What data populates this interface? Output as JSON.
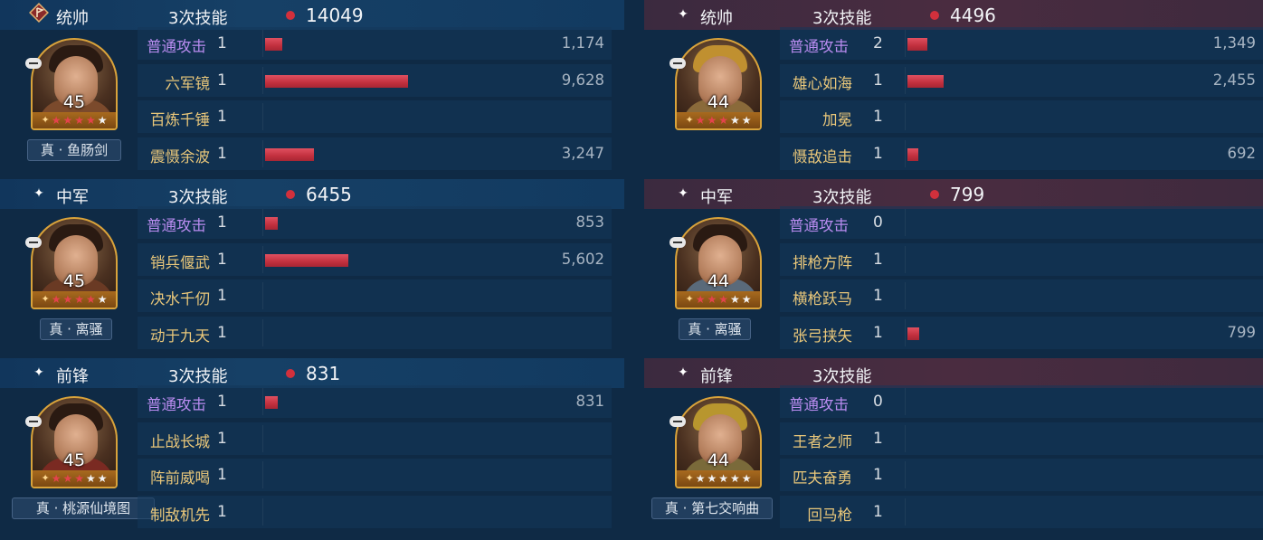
{
  "left": {
    "blocks": [
      {
        "role": "统帅",
        "role_icon": "flag-diamond-icon",
        "skills_label": "3次技能",
        "total": "14049",
        "hero": {
          "level": "45",
          "stars_red": 4,
          "equipment": "真 · 鱼肠剑"
        },
        "rows": [
          {
            "name": "普通攻击",
            "count": "1",
            "bar_fraction": 0.022,
            "damage": "1,174",
            "normal": true
          },
          {
            "name": "六军镜",
            "count": "1",
            "bar_fraction": 0.18,
            "damage": "9,628",
            "normal": false
          },
          {
            "name": "百炼千锤",
            "count": "1",
            "bar_fraction": 0,
            "damage": "",
            "normal": false
          },
          {
            "name": "震慑余波",
            "count": "1",
            "bar_fraction": 0.061,
            "damage": "3,247",
            "normal": false
          }
        ]
      },
      {
        "role": "中军",
        "role_icon": "sparkle-icon",
        "skills_label": "3次技能",
        "total": "6455",
        "hero": {
          "level": "45",
          "stars_red": 4,
          "equipment": "真 · 离骚"
        },
        "rows": [
          {
            "name": "普通攻击",
            "count": "1",
            "bar_fraction": 0.016,
            "damage": "853",
            "normal": true
          },
          {
            "name": "销兵偃武",
            "count": "1",
            "bar_fraction": 0.105,
            "damage": "5,602",
            "normal": false
          },
          {
            "name": "决水千仞",
            "count": "1",
            "bar_fraction": 0,
            "damage": "",
            "normal": false
          },
          {
            "name": "动于九天",
            "count": "1",
            "bar_fraction": 0,
            "damage": "",
            "normal": false
          }
        ]
      },
      {
        "role": "前锋",
        "role_icon": "sparkle-icon",
        "skills_label": "3次技能",
        "total": "831",
        "hero": {
          "level": "45",
          "stars_red": 3,
          "equipment": "真 · 桃源仙境图"
        },
        "rows": [
          {
            "name": "普通攻击",
            "count": "1",
            "bar_fraction": 0.016,
            "damage": "831",
            "normal": true
          },
          {
            "name": "止战长城",
            "count": "1",
            "bar_fraction": 0,
            "damage": "",
            "normal": false
          },
          {
            "name": "阵前威喝",
            "count": "1",
            "bar_fraction": 0,
            "damage": "",
            "normal": false
          },
          {
            "name": "制敌机先",
            "count": "1",
            "bar_fraction": 0,
            "damage": "",
            "normal": false
          }
        ]
      }
    ]
  },
  "right": {
    "blocks": [
      {
        "role": "统帅",
        "role_icon": "sparkle-icon",
        "skills_label": "3次技能",
        "total": "4496",
        "hero": {
          "level": "44",
          "stars_red": 3,
          "equipment": ""
        },
        "rows": [
          {
            "name": "普通攻击",
            "count": "2",
            "bar_fraction": 0.025,
            "damage": "1,349",
            "normal": true
          },
          {
            "name": "雄心如海",
            "count": "1",
            "bar_fraction": 0.046,
            "damage": "2,455",
            "normal": false
          },
          {
            "name": "加冕",
            "count": "1",
            "bar_fraction": 0,
            "damage": "",
            "normal": false
          },
          {
            "name": "慑敌追击",
            "count": "1",
            "bar_fraction": 0.013,
            "damage": "692",
            "normal": false
          }
        ]
      },
      {
        "role": "中军",
        "role_icon": "sparkle-icon",
        "skills_label": "3次技能",
        "total": "799",
        "hero": {
          "level": "44",
          "stars_red": 3,
          "equipment": "真 · 离骚"
        },
        "rows": [
          {
            "name": "普通攻击",
            "count": "0",
            "bar_fraction": 0,
            "damage": "",
            "normal": true
          },
          {
            "name": "排枪方阵",
            "count": "1",
            "bar_fraction": 0,
            "damage": "",
            "normal": false
          },
          {
            "name": "横枪跃马",
            "count": "1",
            "bar_fraction": 0,
            "damage": "",
            "normal": false
          },
          {
            "name": "张弓挟矢",
            "count": "1",
            "bar_fraction": 0.015,
            "damage": "799",
            "normal": false
          }
        ]
      },
      {
        "role": "前锋",
        "role_icon": "sparkle-icon",
        "skills_label": "3次技能",
        "total": "",
        "hero": {
          "level": "44",
          "stars_red": 0,
          "equipment": "真 · 第七交响曲"
        },
        "rows": [
          {
            "name": "普通攻击",
            "count": "0",
            "bar_fraction": 0,
            "damage": "",
            "normal": true
          },
          {
            "name": "王者之师",
            "count": "1",
            "bar_fraction": 0,
            "damage": "",
            "normal": false
          },
          {
            "name": "匹夫奋勇",
            "count": "1",
            "bar_fraction": 0,
            "damage": "",
            "normal": false
          },
          {
            "name": "回马枪",
            "count": "1",
            "bar_fraction": 0,
            "damage": "",
            "normal": false
          }
        ]
      }
    ]
  },
  "colors": {
    "background": "#0f2a45",
    "bar": "#c2303e",
    "skill_name": "#e9c77a",
    "normal_attack": "#b98cf0",
    "star_red": "#e3434c",
    "frame_gold": "#d9a33b"
  }
}
